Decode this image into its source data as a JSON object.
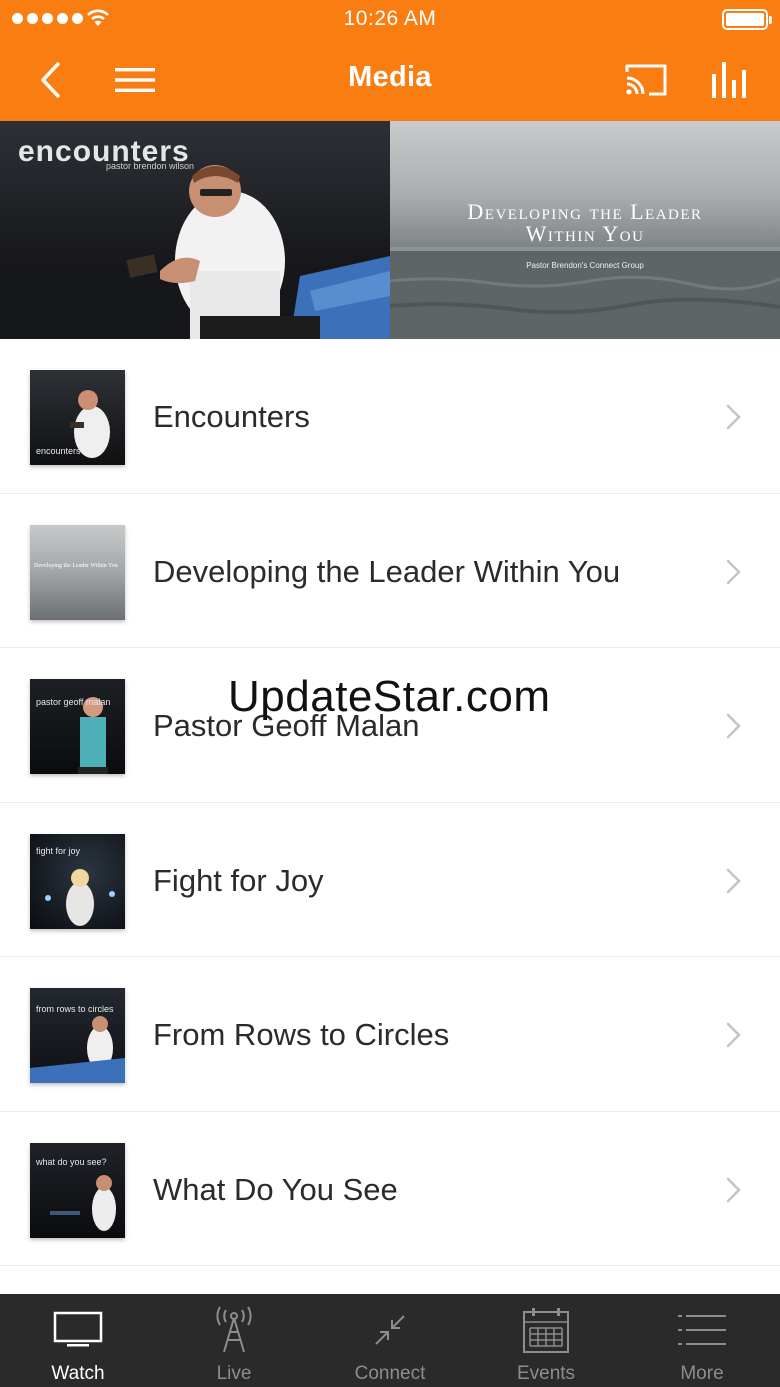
{
  "status_bar": {
    "time": "10:26 AM"
  },
  "nav": {
    "title": "Media"
  },
  "accent_color": "#fa7d12",
  "banners": [
    {
      "title": "encounters",
      "subtitle": "pastor brendon wilson"
    },
    {
      "title_line1": "Developing the Leader",
      "title_line2": "Within You",
      "subtitle": "Pastor Brendon's Connect Group"
    }
  ],
  "items": [
    {
      "title": "Encounters",
      "thumb_text": "encounters"
    },
    {
      "title": "Developing the Leader Within You",
      "thumb_text": "Developing the Leader Within You"
    },
    {
      "title": "Pastor Geoff Malan",
      "thumb_text": "pastor geoff malan"
    },
    {
      "title": "Fight for Joy",
      "thumb_text": "fight for joy"
    },
    {
      "title": "From Rows to Circles",
      "thumb_text": "from rows to circles"
    },
    {
      "title": "What Do You See",
      "thumb_text": "what do you see?"
    }
  ],
  "watermark": "UpdateStar.com",
  "tabs": [
    {
      "label": "Watch",
      "icon": "tv-icon",
      "active": true
    },
    {
      "label": "Live",
      "icon": "broadcast-tower-icon",
      "active": false
    },
    {
      "label": "Connect",
      "icon": "connect-arrows-icon",
      "active": false
    },
    {
      "label": "Events",
      "icon": "calendar-icon",
      "active": false
    },
    {
      "label": "More",
      "icon": "list-icon",
      "active": false
    }
  ]
}
